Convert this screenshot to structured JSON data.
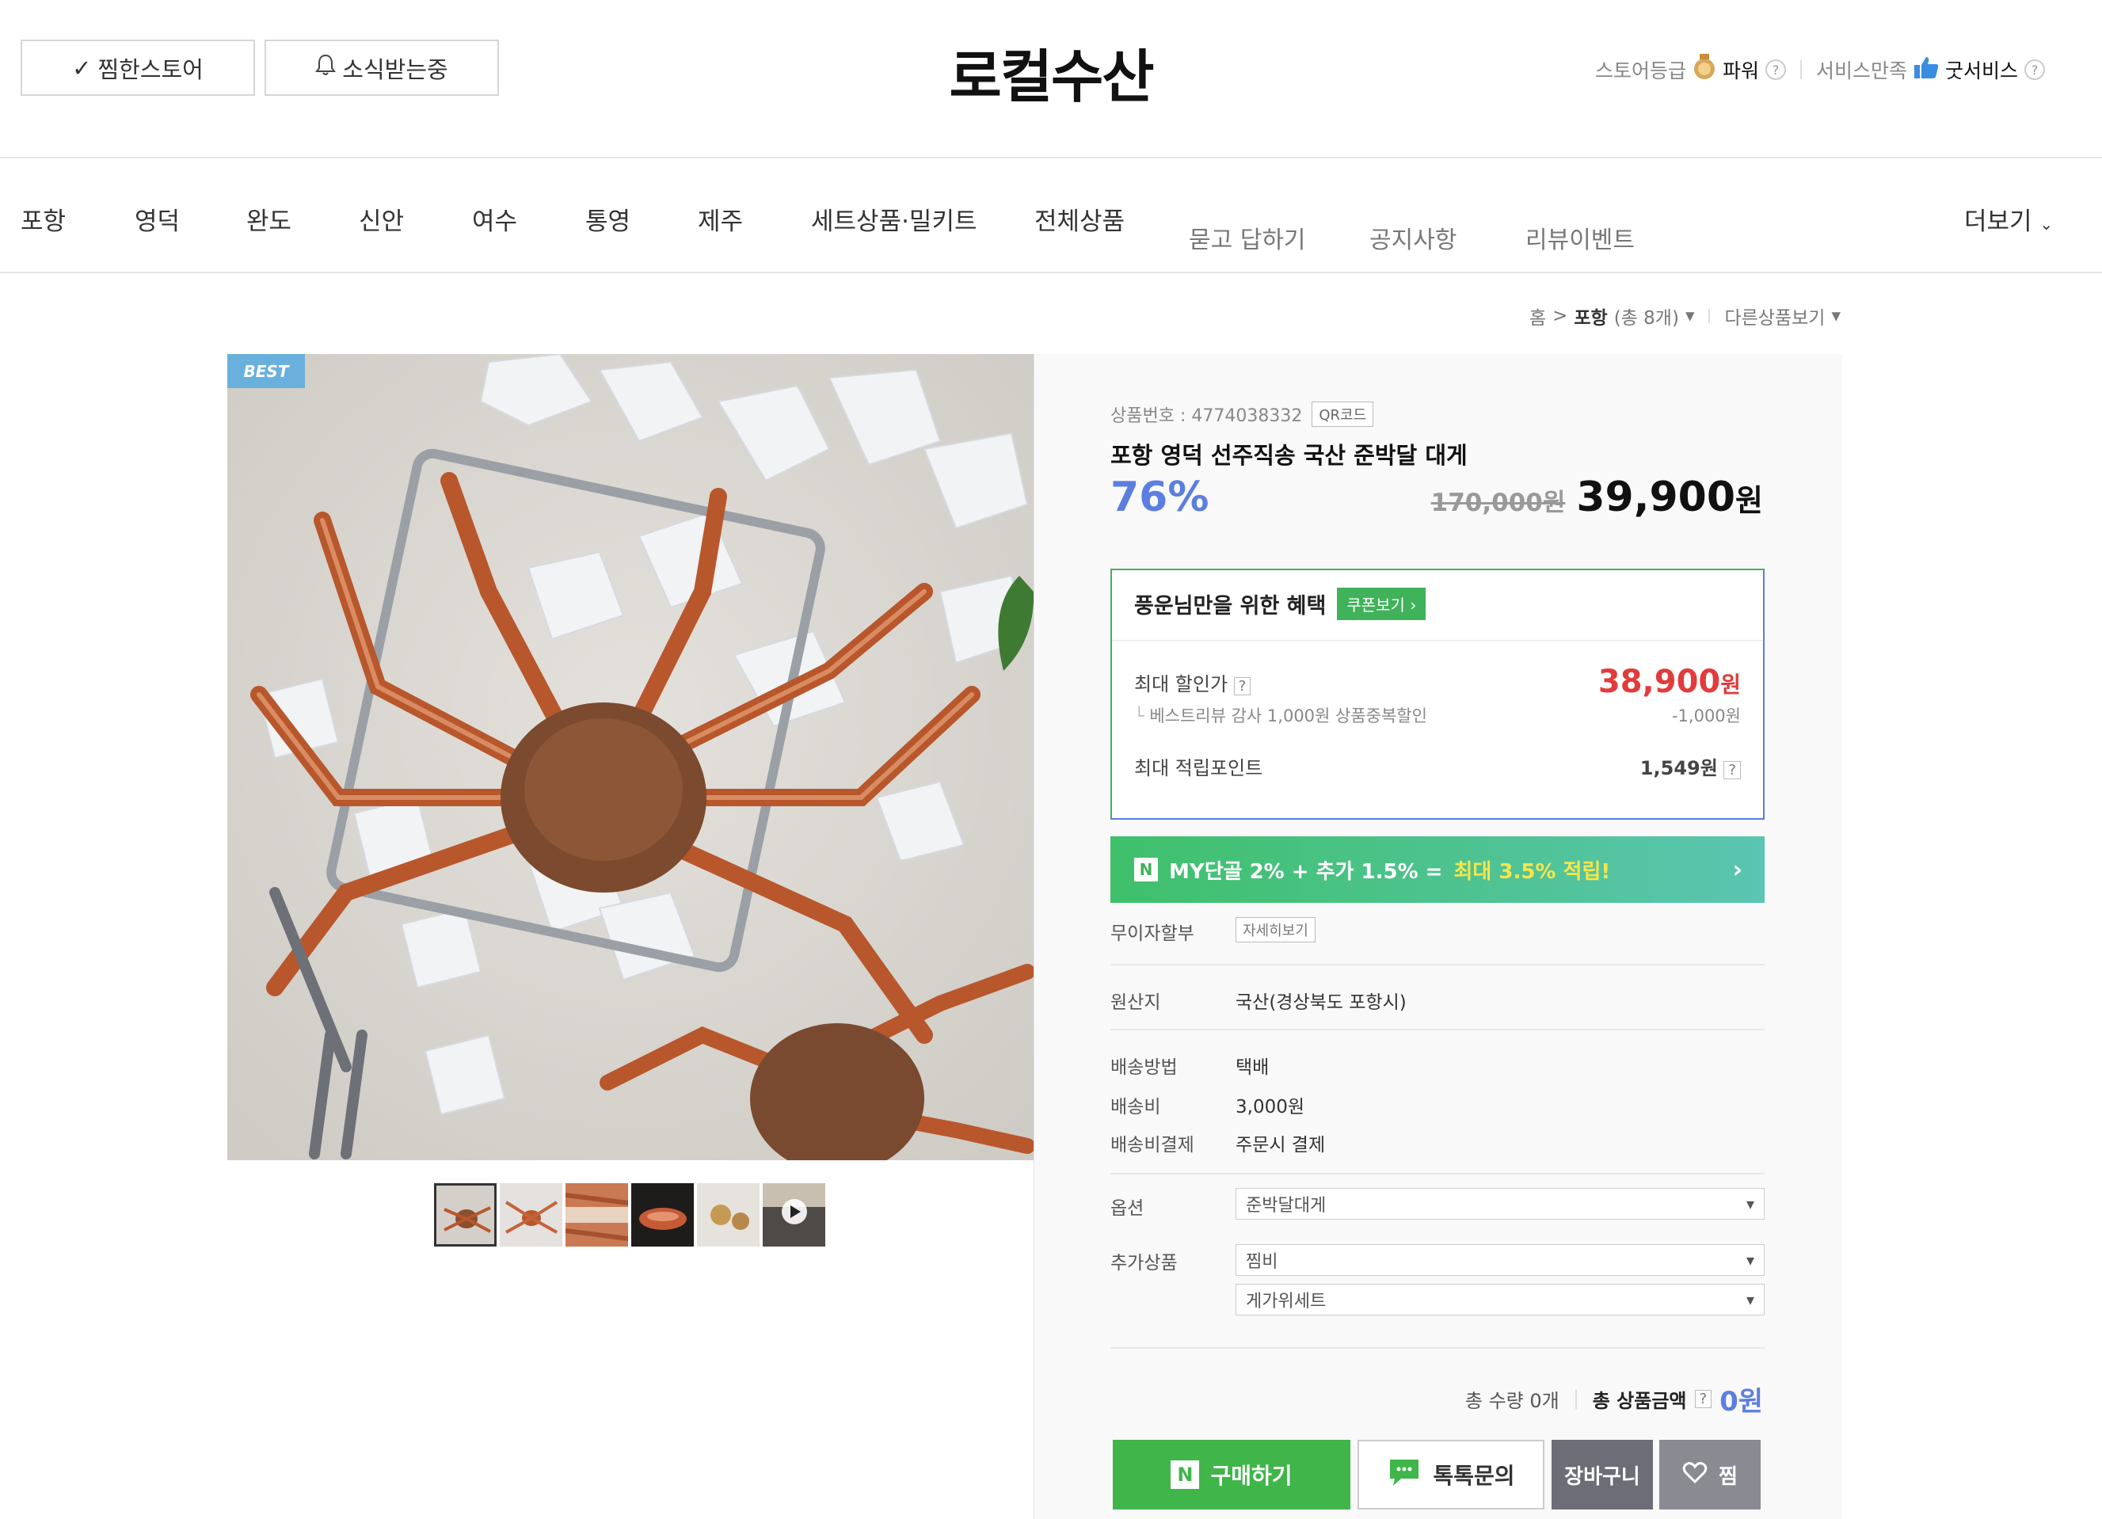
{
  "header": {
    "zzim_store_label": "찜한스토어",
    "notify_label": "소식받는중",
    "store_name": "로컬수산",
    "grade_label": "스토어등급",
    "grade_value": "파워",
    "service_label": "서비스만족",
    "service_value": "굿서비스"
  },
  "nav": {
    "items": [
      "포항",
      "영덕",
      "완도",
      "신안",
      "여수",
      "통영",
      "제주",
      "세트상품·밀키트",
      "전체상품"
    ],
    "sub_items": [
      "묻고 답하기",
      "공지사항",
      "리뷰이벤트"
    ],
    "more_label": "더보기"
  },
  "breadcrumb": {
    "home": "홈",
    "category": "포항",
    "count_text": "(총 8개)",
    "other_label": "다른상품보기"
  },
  "product": {
    "badge": "BEST",
    "product_no_label": "상품번호 : 4774038332",
    "qr_label": "QR코드",
    "title": "포항 영덕 선주직송 국산 준박달 대게",
    "discount": "76%",
    "original_price": "170,000원",
    "price_number": "39,900",
    "price_unit": "원"
  },
  "benefit": {
    "title": "풍운님만을 위한 혜택",
    "coupon_label": "쿠폰보기",
    "max_discount_label": "최대 할인가",
    "max_discount_value": "38,900",
    "won": "원",
    "review_label": "베스트리뷰 감사 1,000원 상품중복할인",
    "review_value": "-1,000원",
    "points_label": "최대 적립포인트",
    "points_value": "1,549원"
  },
  "npay": {
    "text": "MY단골 2% + 추가 1.5% =",
    "highlight": "최대 3.5% 적립!"
  },
  "details": {
    "installment_label": "무이자할부",
    "installment_btn": "자세히보기",
    "origin_label": "원산지",
    "origin_value": "국산(경상북도 포항시)",
    "ship_method_label": "배송방법",
    "ship_method_value": "택배",
    "ship_fee_label": "배송비",
    "ship_fee_value": "3,000원",
    "ship_pay_label": "배송비결제",
    "ship_pay_value": "주문시 결제",
    "option_label": "옵션",
    "option_value": "준박달대게",
    "addon_label": "추가상품",
    "addon_values": [
      "찜비",
      "게가위세트"
    ]
  },
  "total": {
    "qty_text": "총 수량 0개",
    "amount_label": "총 상품금액",
    "amount_value": "0원"
  },
  "actions": {
    "buy": "구매하기",
    "talk": "톡톡문의",
    "cart": "장바구니",
    "zzim": "찜"
  }
}
